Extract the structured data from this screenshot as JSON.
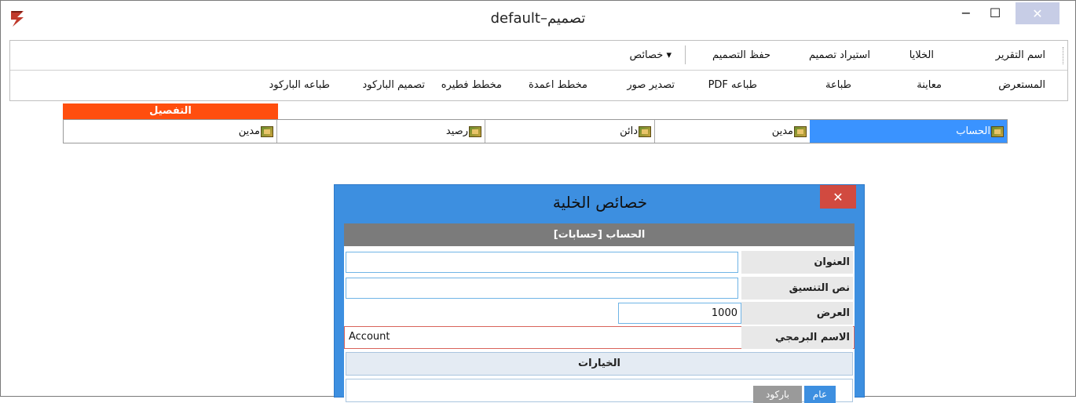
{
  "window": {
    "title": "default–تصميم",
    "minimize_glyph": "−",
    "maximize_glyph": "☐",
    "close_glyph": "✕"
  },
  "menu_row1": {
    "report_name": "اسم التقرير",
    "cells": "الخلايا",
    "import_design": "استيراد تصميم",
    "save_design": "حفظ التصميم",
    "properties": "▾ خصائص"
  },
  "menu_row2": {
    "viewer": "المستعرض",
    "preview": "معاينة",
    "print": "طباعة",
    "print_pdf": "طباعه PDF",
    "export_images": "تصدير صور",
    "column_chart": "مخطط اعمدة",
    "pie_chart": "مخطط فطيره",
    "barcode_design": "تصميم الباركود",
    "barcode_print": "طباعه الباركود"
  },
  "detail_band": {
    "label": "التفصيل",
    "color": "#ff4e0e"
  },
  "cells": [
    {
      "label": "الحساب",
      "selected": true
    },
    {
      "label": "مدين",
      "selected": false
    },
    {
      "label": "دائن",
      "selected": false
    },
    {
      "label": "رصيد",
      "selected": false
    },
    {
      "label": "مدين",
      "selected": false
    }
  ],
  "dialog": {
    "title": "خصائص الخلية",
    "close_glyph": "✕",
    "header": "الحساب [حسابات]",
    "fields": {
      "title_label": "العنوان",
      "title_value": "",
      "format_label": "نص التنسيق",
      "format_value": "",
      "width_label": "العرض",
      "width_value": "1000",
      "name_label": "الاسم البرمجي",
      "name_value": "Account"
    },
    "options_label": "الخيارات",
    "tabs": {
      "general": "عام",
      "barcode": "باركود"
    }
  }
}
